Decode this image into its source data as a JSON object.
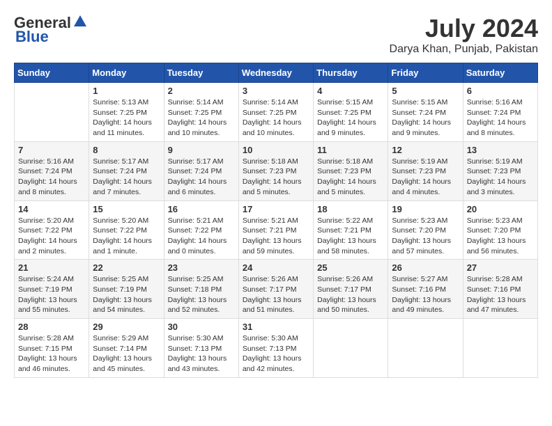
{
  "logo": {
    "general": "General",
    "blue": "Blue"
  },
  "title": {
    "month": "July 2024",
    "location": "Darya Khan, Punjab, Pakistan"
  },
  "headers": [
    "Sunday",
    "Monday",
    "Tuesday",
    "Wednesday",
    "Thursday",
    "Friday",
    "Saturday"
  ],
  "weeks": [
    [
      {
        "day": "",
        "sunrise": "",
        "sunset": "",
        "daylight": ""
      },
      {
        "day": "1",
        "sunrise": "Sunrise: 5:13 AM",
        "sunset": "Sunset: 7:25 PM",
        "daylight": "Daylight: 14 hours and 11 minutes."
      },
      {
        "day": "2",
        "sunrise": "Sunrise: 5:14 AM",
        "sunset": "Sunset: 7:25 PM",
        "daylight": "Daylight: 14 hours and 10 minutes."
      },
      {
        "day": "3",
        "sunrise": "Sunrise: 5:14 AM",
        "sunset": "Sunset: 7:25 PM",
        "daylight": "Daylight: 14 hours and 10 minutes."
      },
      {
        "day": "4",
        "sunrise": "Sunrise: 5:15 AM",
        "sunset": "Sunset: 7:25 PM",
        "daylight": "Daylight: 14 hours and 9 minutes."
      },
      {
        "day": "5",
        "sunrise": "Sunrise: 5:15 AM",
        "sunset": "Sunset: 7:24 PM",
        "daylight": "Daylight: 14 hours and 9 minutes."
      },
      {
        "day": "6",
        "sunrise": "Sunrise: 5:16 AM",
        "sunset": "Sunset: 7:24 PM",
        "daylight": "Daylight: 14 hours and 8 minutes."
      }
    ],
    [
      {
        "day": "7",
        "sunrise": "Sunrise: 5:16 AM",
        "sunset": "Sunset: 7:24 PM",
        "daylight": "Daylight: 14 hours and 8 minutes."
      },
      {
        "day": "8",
        "sunrise": "Sunrise: 5:17 AM",
        "sunset": "Sunset: 7:24 PM",
        "daylight": "Daylight: 14 hours and 7 minutes."
      },
      {
        "day": "9",
        "sunrise": "Sunrise: 5:17 AM",
        "sunset": "Sunset: 7:24 PM",
        "daylight": "Daylight: 14 hours and 6 minutes."
      },
      {
        "day": "10",
        "sunrise": "Sunrise: 5:18 AM",
        "sunset": "Sunset: 7:23 PM",
        "daylight": "Daylight: 14 hours and 5 minutes."
      },
      {
        "day": "11",
        "sunrise": "Sunrise: 5:18 AM",
        "sunset": "Sunset: 7:23 PM",
        "daylight": "Daylight: 14 hours and 5 minutes."
      },
      {
        "day": "12",
        "sunrise": "Sunrise: 5:19 AM",
        "sunset": "Sunset: 7:23 PM",
        "daylight": "Daylight: 14 hours and 4 minutes."
      },
      {
        "day": "13",
        "sunrise": "Sunrise: 5:19 AM",
        "sunset": "Sunset: 7:23 PM",
        "daylight": "Daylight: 14 hours and 3 minutes."
      }
    ],
    [
      {
        "day": "14",
        "sunrise": "Sunrise: 5:20 AM",
        "sunset": "Sunset: 7:22 PM",
        "daylight": "Daylight: 14 hours and 2 minutes."
      },
      {
        "day": "15",
        "sunrise": "Sunrise: 5:20 AM",
        "sunset": "Sunset: 7:22 PM",
        "daylight": "Daylight: 14 hours and 1 minute."
      },
      {
        "day": "16",
        "sunrise": "Sunrise: 5:21 AM",
        "sunset": "Sunset: 7:22 PM",
        "daylight": "Daylight: 14 hours and 0 minutes."
      },
      {
        "day": "17",
        "sunrise": "Sunrise: 5:21 AM",
        "sunset": "Sunset: 7:21 PM",
        "daylight": "Daylight: 13 hours and 59 minutes."
      },
      {
        "day": "18",
        "sunrise": "Sunrise: 5:22 AM",
        "sunset": "Sunset: 7:21 PM",
        "daylight": "Daylight: 13 hours and 58 minutes."
      },
      {
        "day": "19",
        "sunrise": "Sunrise: 5:23 AM",
        "sunset": "Sunset: 7:20 PM",
        "daylight": "Daylight: 13 hours and 57 minutes."
      },
      {
        "day": "20",
        "sunrise": "Sunrise: 5:23 AM",
        "sunset": "Sunset: 7:20 PM",
        "daylight": "Daylight: 13 hours and 56 minutes."
      }
    ],
    [
      {
        "day": "21",
        "sunrise": "Sunrise: 5:24 AM",
        "sunset": "Sunset: 7:19 PM",
        "daylight": "Daylight: 13 hours and 55 minutes."
      },
      {
        "day": "22",
        "sunrise": "Sunrise: 5:25 AM",
        "sunset": "Sunset: 7:19 PM",
        "daylight": "Daylight: 13 hours and 54 minutes."
      },
      {
        "day": "23",
        "sunrise": "Sunrise: 5:25 AM",
        "sunset": "Sunset: 7:18 PM",
        "daylight": "Daylight: 13 hours and 52 minutes."
      },
      {
        "day": "24",
        "sunrise": "Sunrise: 5:26 AM",
        "sunset": "Sunset: 7:17 PM",
        "daylight": "Daylight: 13 hours and 51 minutes."
      },
      {
        "day": "25",
        "sunrise": "Sunrise: 5:26 AM",
        "sunset": "Sunset: 7:17 PM",
        "daylight": "Daylight: 13 hours and 50 minutes."
      },
      {
        "day": "26",
        "sunrise": "Sunrise: 5:27 AM",
        "sunset": "Sunset: 7:16 PM",
        "daylight": "Daylight: 13 hours and 49 minutes."
      },
      {
        "day": "27",
        "sunrise": "Sunrise: 5:28 AM",
        "sunset": "Sunset: 7:16 PM",
        "daylight": "Daylight: 13 hours and 47 minutes."
      }
    ],
    [
      {
        "day": "28",
        "sunrise": "Sunrise: 5:28 AM",
        "sunset": "Sunset: 7:15 PM",
        "daylight": "Daylight: 13 hours and 46 minutes."
      },
      {
        "day": "29",
        "sunrise": "Sunrise: 5:29 AM",
        "sunset": "Sunset: 7:14 PM",
        "daylight": "Daylight: 13 hours and 45 minutes."
      },
      {
        "day": "30",
        "sunrise": "Sunrise: 5:30 AM",
        "sunset": "Sunset: 7:13 PM",
        "daylight": "Daylight: 13 hours and 43 minutes."
      },
      {
        "day": "31",
        "sunrise": "Sunrise: 5:30 AM",
        "sunset": "Sunset: 7:13 PM",
        "daylight": "Daylight: 13 hours and 42 minutes."
      },
      {
        "day": "",
        "sunrise": "",
        "sunset": "",
        "daylight": ""
      },
      {
        "day": "",
        "sunrise": "",
        "sunset": "",
        "daylight": ""
      },
      {
        "day": "",
        "sunrise": "",
        "sunset": "",
        "daylight": ""
      }
    ]
  ]
}
